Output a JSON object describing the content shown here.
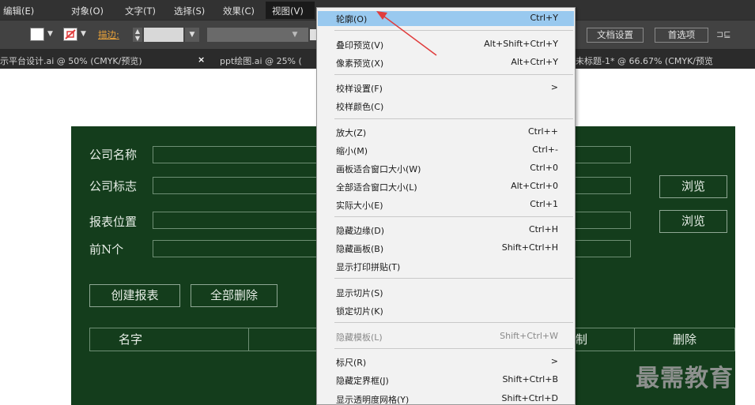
{
  "menubar": {
    "items": [
      "编辑(E)",
      "对象(O)",
      "文字(T)",
      "选择(S)",
      "效果(C)",
      "视图(V)"
    ]
  },
  "toolbar": {
    "stroke_label": "描边:",
    "doc_settings": "文档设置",
    "preferences": "首选项"
  },
  "tabs": {
    "left": "示平台设计.ai @ 50% (CMYK/预览)",
    "close": "×",
    "middle": "ppt绘图.ai @ 25% (",
    "right": "未标题-1* @ 66.67% (CMYK/预览"
  },
  "form": {
    "company_name": "公司名称",
    "company_logo": "公司标志",
    "report_location": "报表位置",
    "top_n": "前N个",
    "browse1": "浏览",
    "browse2": "浏览",
    "create_report": "创建报表",
    "delete_all": "全部删除",
    "col_name": "名字",
    "col_copy": "复制",
    "col_delete": "删除"
  },
  "view_menu": {
    "items": [
      {
        "label": "轮廓(O)",
        "shortcut": "Ctrl+Y"
      },
      {
        "label": "叠印预览(V)",
        "shortcut": "Alt+Shift+Ctrl+Y"
      },
      {
        "label": "像素预览(X)",
        "shortcut": "Alt+Ctrl+Y"
      },
      {
        "label": "校样设置(F)",
        "shortcut": ">"
      },
      {
        "label": "校样颜色(C)",
        "shortcut": ""
      },
      {
        "label": "放大(Z)",
        "shortcut": "Ctrl++"
      },
      {
        "label": "缩小(M)",
        "shortcut": "Ctrl+-"
      },
      {
        "label": "画板适合窗口大小(W)",
        "shortcut": "Ctrl+0"
      },
      {
        "label": "全部适合窗口大小(L)",
        "shortcut": "Alt+Ctrl+0"
      },
      {
        "label": "实际大小(E)",
        "shortcut": "Ctrl+1"
      },
      {
        "label": "隐藏边缘(D)",
        "shortcut": "Ctrl+H"
      },
      {
        "label": "隐藏画板(B)",
        "shortcut": "Shift+Ctrl+H"
      },
      {
        "label": "显示打印拼贴(T)",
        "shortcut": ""
      },
      {
        "label": "显示切片(S)",
        "shortcut": ""
      },
      {
        "label": "锁定切片(K)",
        "shortcut": ""
      },
      {
        "label": "隐藏模板(L)",
        "shortcut": "Shift+Ctrl+W"
      },
      {
        "label": "标尺(R)",
        "shortcut": ">"
      },
      {
        "label": "隐藏定界框(J)",
        "shortcut": "Shift+Ctrl+B"
      },
      {
        "label": "显示透明度网格(Y)",
        "shortcut": "Shift+Ctrl+D"
      }
    ]
  },
  "watermark": "最需教育",
  "colors": {
    "panel_bg": "#143d1c",
    "highlight": "#99c9ef",
    "arrow": "#e03c3c"
  }
}
